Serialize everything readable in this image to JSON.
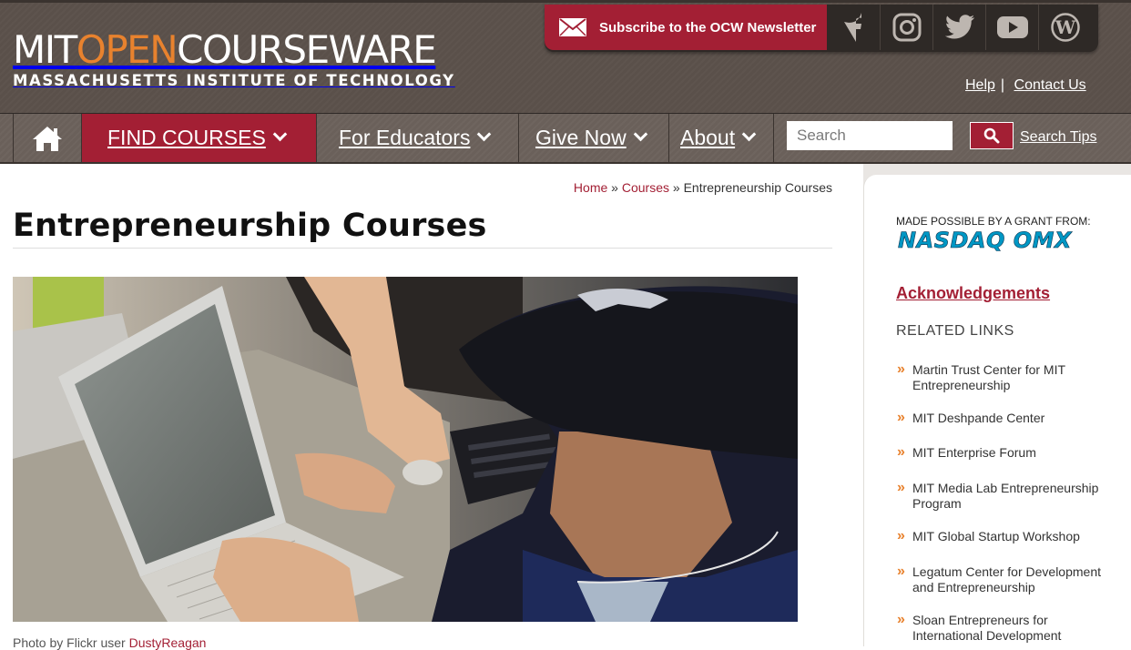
{
  "header": {
    "logo": {
      "mit": "MIT",
      "open": "OPEN",
      "courseware": "COURSEWARE",
      "subtitle": "MASSACHUSETTS INSTITUTE OF TECHNOLOGY"
    },
    "subscribe_label": "Subscribe to the OCW Newsletter",
    "social_icons": [
      "facebook-icon",
      "instagram-icon",
      "twitter-icon",
      "youtube-icon",
      "wordpress-icon"
    ],
    "help_label": "Help",
    "separator": "|",
    "contact_label": "Contact Us"
  },
  "nav": {
    "home_icon": "home-icon",
    "items": [
      {
        "label": "FIND COURSES",
        "active": true
      },
      {
        "label": "For Educators",
        "active": false
      },
      {
        "label": "Give Now",
        "active": false
      },
      {
        "label": "About",
        "active": false
      }
    ],
    "search_placeholder": "Search",
    "search_icon": "search-icon",
    "search_tips": "Search Tips"
  },
  "breadcrumb": {
    "home": "Home",
    "sep1": "»",
    "courses": "Courses",
    "sep2": "»",
    "current": "Entrepreneurship Courses"
  },
  "main": {
    "title": "Entrepreneurship Courses",
    "caption_prefix": "Photo by Flickr user",
    "caption_user": "DustyReagan"
  },
  "sidebar": {
    "grant_label": "MADE POSSIBLE BY A GRANT FROM:",
    "sponsor": "NASDAQ OMX",
    "acknowledgements": "Acknowledgements",
    "related_heading": "RELATED LINKS",
    "links": [
      "Martin Trust Center for MIT Entrepreneurship",
      "MIT Deshpande Center",
      "MIT Enterprise Forum",
      "MIT Media Lab Entrepreneurship Program",
      "MIT Global Startup Workshop",
      "Legatum Center for Development and Entrepreneurship",
      "Sloan Entrepreneurs for International Development"
    ],
    "link_marker": "»"
  },
  "colors": {
    "accent": "#a31f34",
    "orange": "#e8822e",
    "header_bg": "#5a504a",
    "nav_bg": "#6a605a",
    "nasdaq_blue": "#0097c4"
  }
}
